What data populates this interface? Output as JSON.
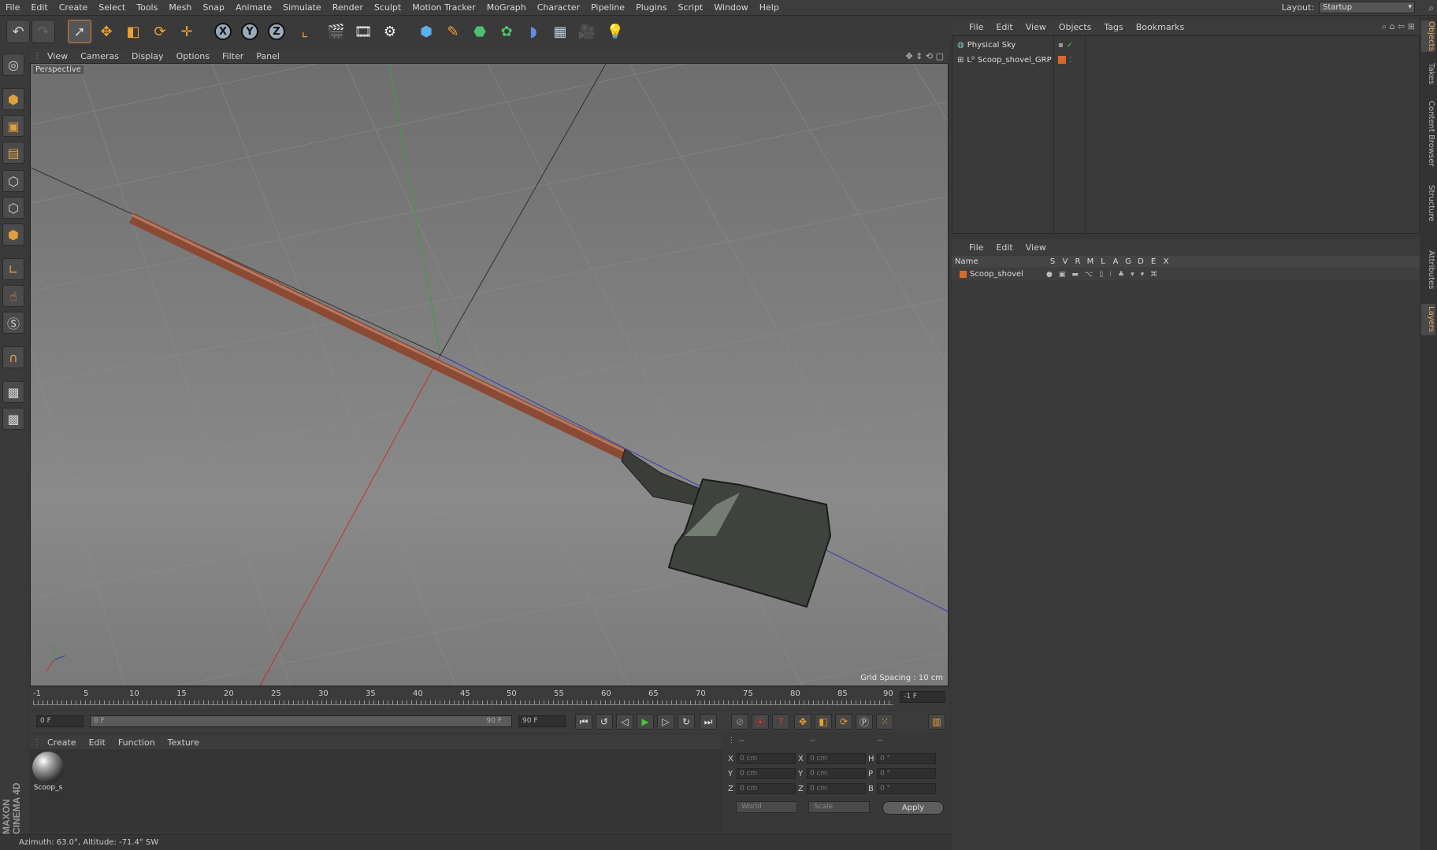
{
  "menubar": {
    "items": [
      "File",
      "Edit",
      "Create",
      "Select",
      "Tools",
      "Mesh",
      "Snap",
      "Animate",
      "Simulate",
      "Render",
      "Sculpt",
      "Motion Tracker",
      "MoGraph",
      "Character",
      "Pipeline",
      "Plugins",
      "Script",
      "Window",
      "Help"
    ],
    "layout_label": "Layout:",
    "layout_value": "Startup"
  },
  "viewport": {
    "menu": [
      "View",
      "Cameras",
      "Display",
      "Options",
      "Filter",
      "Panel"
    ],
    "label": "Perspective",
    "grid_spacing": "Grid Spacing : 10 cm"
  },
  "timeline": {
    "ticks": [
      "-1",
      "5",
      "10",
      "15",
      "20",
      "25",
      "30",
      "35",
      "40",
      "45",
      "50",
      "55",
      "60",
      "65",
      "70",
      "75",
      "80",
      "85",
      "90"
    ],
    "end_field": "-1 F",
    "current_frame": "0 F",
    "range_start": "0 F",
    "range_end": "90 F",
    "max_frame": "90 F"
  },
  "material_manager": {
    "menu": [
      "Create",
      "Edit",
      "Function",
      "Texture"
    ],
    "material_name": "Scoop_s"
  },
  "coordinates": {
    "header": [
      "--",
      "--",
      "--"
    ],
    "rows": [
      {
        "a1": "X",
        "v1": "0 cm",
        "a2": "X",
        "v2": "0 cm",
        "a3": "H",
        "v3": "0 °"
      },
      {
        "a1": "Y",
        "v1": "0 cm",
        "a2": "Y",
        "v2": "0 cm",
        "a3": "P",
        "v3": "0 °"
      },
      {
        "a1": "Z",
        "v1": "0 cm",
        "a2": "Z",
        "v2": "0 cm",
        "a3": "B",
        "v3": "0 °"
      }
    ],
    "mode_world": "World",
    "mode_scale": "Scale",
    "apply": "Apply"
  },
  "status": "Azimuth: 63.0°, Altitude: -71.4°  SW",
  "logo": "MAXON CINEMA 4D",
  "object_manager": {
    "menu": [
      "File",
      "Edit",
      "View",
      "Objects",
      "Tags",
      "Bookmarks"
    ],
    "objects": [
      {
        "name": "Physical Sky",
        "icon": "sky-icon"
      },
      {
        "name": "Scoop_shovel_GRP",
        "icon": "null-icon"
      }
    ]
  },
  "layer_manager": {
    "menu": [
      "File",
      "Edit",
      "View"
    ],
    "columns": [
      "Name",
      "S",
      "V",
      "R",
      "M",
      "L",
      "A",
      "G",
      "D",
      "E",
      "X"
    ],
    "layers": [
      {
        "name": "Scoop_shovel"
      }
    ]
  },
  "right_tabs": [
    "Objects",
    "Takes",
    "Content Browser",
    "Structure",
    "Attributes",
    "Layers"
  ],
  "colors": {
    "accent": "#e07b2a",
    "layer_color": "#d8692a"
  }
}
